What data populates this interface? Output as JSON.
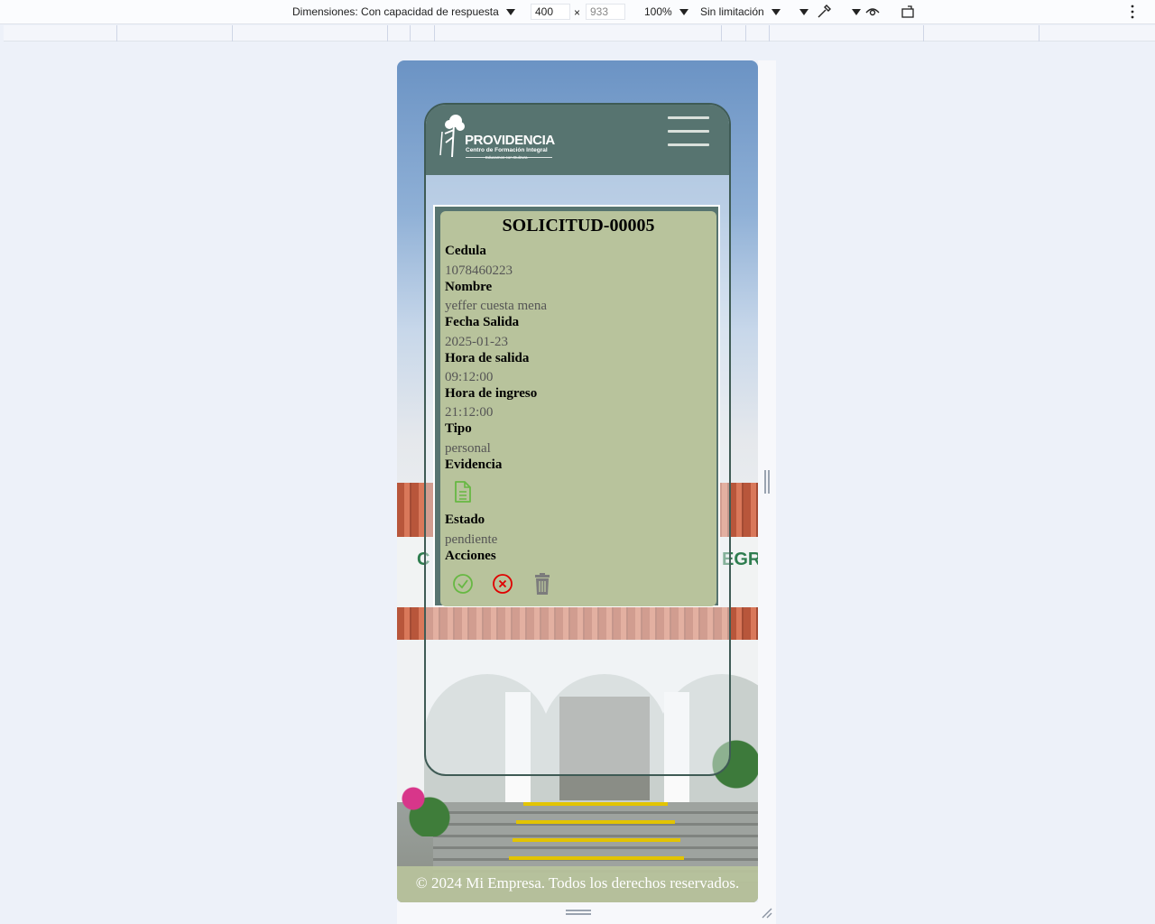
{
  "devtools": {
    "dimensions_label": "Dimensiones: Con capacidad de respuesta",
    "width_value": "400",
    "height_value": "933",
    "times": "×",
    "zoom": "100%",
    "throttle": "Sin limitación"
  },
  "header": {
    "logo_title": "PROVIDENCIA",
    "logo_subtitle": "Centro de Formación Integral",
    "logo_slogan": "Educamos con Dulzura"
  },
  "background_sign": {
    "left_letters": "C",
    "right_letters": "EGR"
  },
  "solicitud": {
    "title": "SOLICITUD-00005",
    "fields": [
      {
        "label": "Cedula",
        "value": "1078460223"
      },
      {
        "label": "Nombre",
        "value": "yeffer cuesta mena"
      },
      {
        "label": "Fecha Salida",
        "value": "2025-01-23"
      },
      {
        "label": "Hora de salida",
        "value": "09:12:00"
      },
      {
        "label": "Hora de ingreso",
        "value": "21:12:00"
      },
      {
        "label": "Tipo",
        "value": "personal"
      }
    ],
    "evidence_label": "Evidencia",
    "estado_label": "Estado",
    "estado_value": "pendiente",
    "acciones_label": "Acciones"
  },
  "icons": {
    "evidence": "document-icon",
    "approve": "check-circle-icon",
    "reject": "x-circle-icon",
    "delete": "trash-icon"
  },
  "colors": {
    "header_bg": "#577470",
    "panel_bg": "#b8c39c",
    "approve": "#67b843",
    "reject": "#e00000",
    "delete": "#7c7c7c"
  },
  "footer": {
    "text": "© 2024 Mi Empresa. Todos los derechos reservados."
  }
}
